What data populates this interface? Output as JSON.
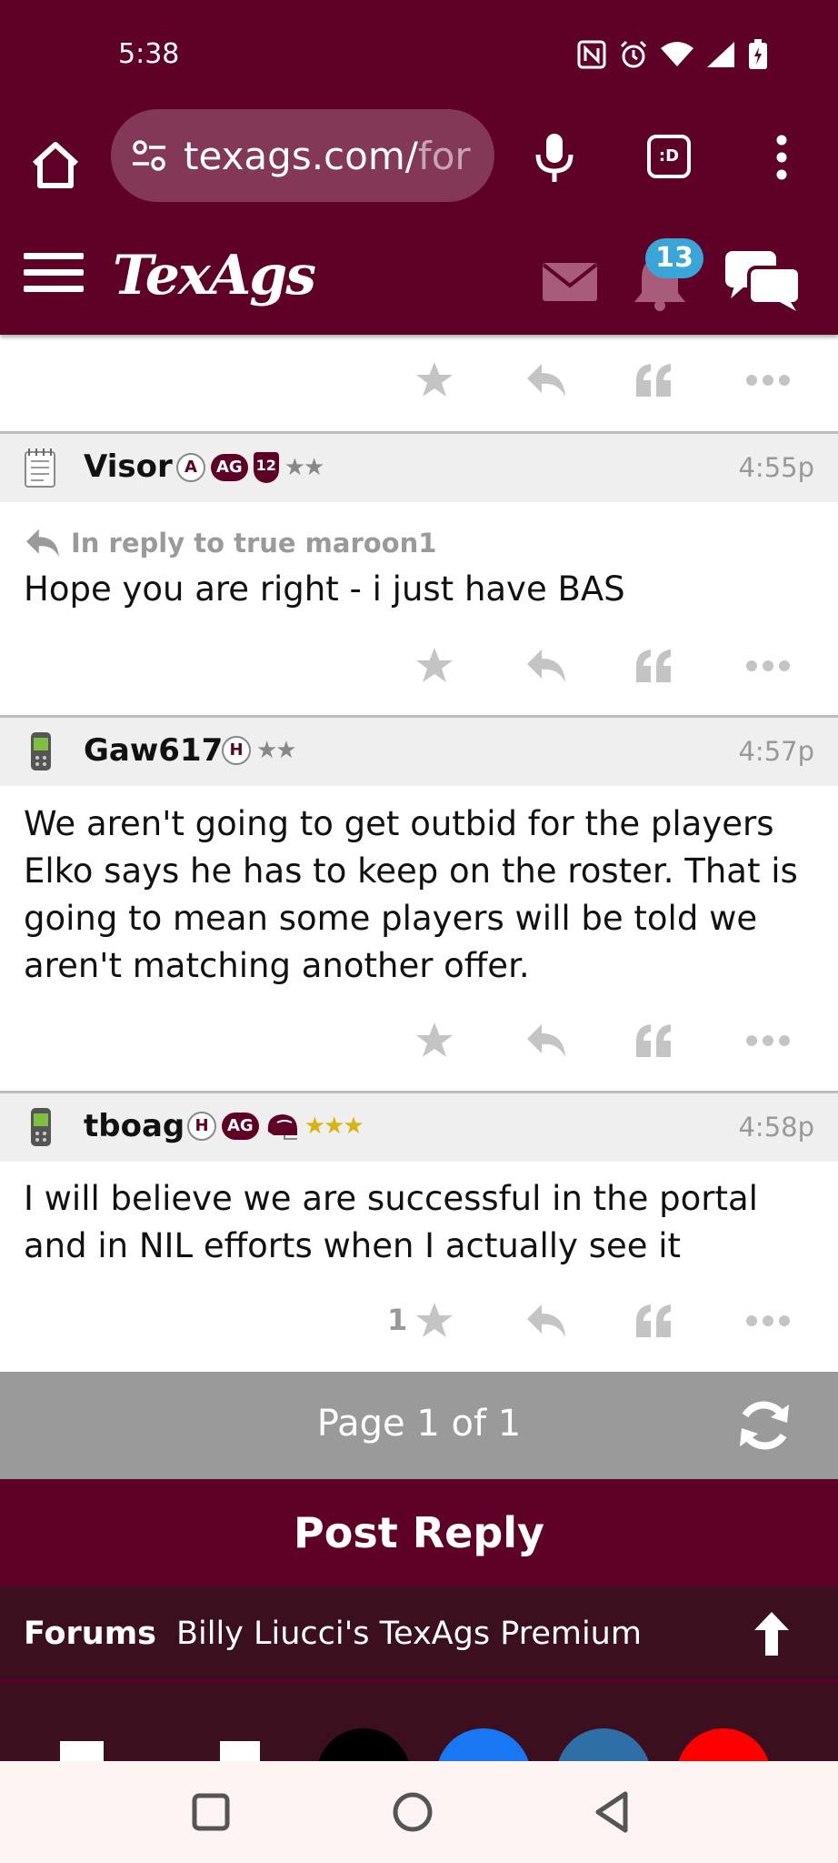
{
  "status_bar": {
    "time": "5:38"
  },
  "browser": {
    "url_main": "texags.com/",
    "url_rest": "for",
    "tabs_label": ":D"
  },
  "site": {
    "logo": "TexAgs",
    "notification_count": "13"
  },
  "posts": [
    {
      "user": "Visor",
      "time": "4:55p",
      "badges": [
        "A",
        "AG",
        "12",
        "★★"
      ],
      "reply_to": "In reply to true maroon1",
      "body": "Hope you are right - i just have BAS",
      "likes": ""
    },
    {
      "user": "Gaw617",
      "time": "4:57p",
      "badges": [
        "H",
        "★★"
      ],
      "reply_to": "",
      "body": "We aren't going to get outbid for the players Elko says he has to keep on the roster. That is going to mean some players will be told we aren't matching another offer.",
      "likes": ""
    },
    {
      "user": "tboag",
      "time": "4:58p",
      "badges": [
        "H",
        "AG",
        "★★★"
      ],
      "reply_to": "",
      "body": "I will believe we are successful in the portal and in NIL efforts when I actually see it",
      "likes": "1"
    }
  ],
  "pager": {
    "label": "Page 1 of 1"
  },
  "post_reply_label": "Post Reply",
  "breadcrumb": {
    "forums": "Forums",
    "current": "Billy Liucci's TexAgs Premium"
  },
  "colors": {
    "maroon": "#5f0027",
    "dark_maroon": "#3b0f1e",
    "badge_blue": "#3aa6d8",
    "gold_star": "#d7b412"
  }
}
